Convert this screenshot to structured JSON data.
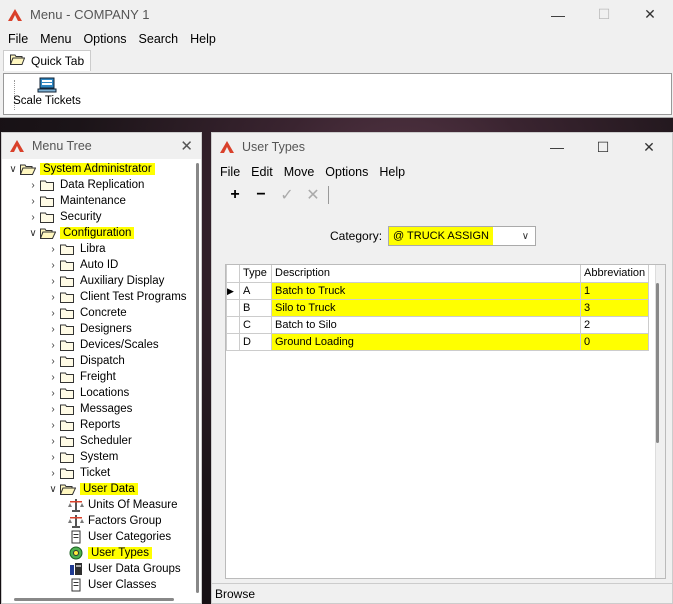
{
  "main_window": {
    "title": "Menu - COMPANY 1",
    "menu": [
      "File",
      "Menu",
      "Options",
      "Search",
      "Help"
    ],
    "tab": "Quick Tab",
    "ribbon_button": "Scale Tickets"
  },
  "tree_panel": {
    "title": "Menu Tree",
    "items": [
      {
        "label": "System Administrator",
        "highlight": true
      },
      {
        "label": "Data Replication"
      },
      {
        "label": "Maintenance"
      },
      {
        "label": "Security"
      },
      {
        "label": "Configuration",
        "highlight": true
      },
      {
        "label": "Libra"
      },
      {
        "label": "Auto ID"
      },
      {
        "label": "Auxiliary Display"
      },
      {
        "label": "Client Test Programs"
      },
      {
        "label": "Concrete"
      },
      {
        "label": "Designers"
      },
      {
        "label": "Devices/Scales"
      },
      {
        "label": "Dispatch"
      },
      {
        "label": "Freight"
      },
      {
        "label": "Locations"
      },
      {
        "label": "Messages"
      },
      {
        "label": "Reports"
      },
      {
        "label": "Scheduler"
      },
      {
        "label": "System"
      },
      {
        "label": "Ticket"
      },
      {
        "label": "User Data",
        "highlight": true
      },
      {
        "label": "Units Of Measure"
      },
      {
        "label": "Factors Group"
      },
      {
        "label": "User Categories"
      },
      {
        "label": "User Types",
        "highlight": true
      },
      {
        "label": "User Data Groups"
      },
      {
        "label": "User Classes"
      }
    ]
  },
  "user_types": {
    "title": "User Types",
    "menu": [
      "File",
      "Edit",
      "Move",
      "Options",
      "Help"
    ],
    "category_label": "Category:",
    "category_value": "@ TRUCK ASSIGN",
    "columns": [
      "Type",
      "Description",
      "Abbreviation"
    ],
    "rows": [
      {
        "type": "A",
        "description": "Batch to Truck",
        "abbreviation": "1",
        "hl": true
      },
      {
        "type": "B",
        "description": "Silo to Truck",
        "abbreviation": "3",
        "hl": true
      },
      {
        "type": "C",
        "description": "Batch to Silo",
        "abbreviation": "2",
        "hl": false
      },
      {
        "type": "D",
        "description": "Ground Loading",
        "abbreviation": "0",
        "hl": true
      }
    ],
    "status": "Browse"
  },
  "colors": {
    "highlight": "#ffff00",
    "accent": "#d9412b"
  }
}
